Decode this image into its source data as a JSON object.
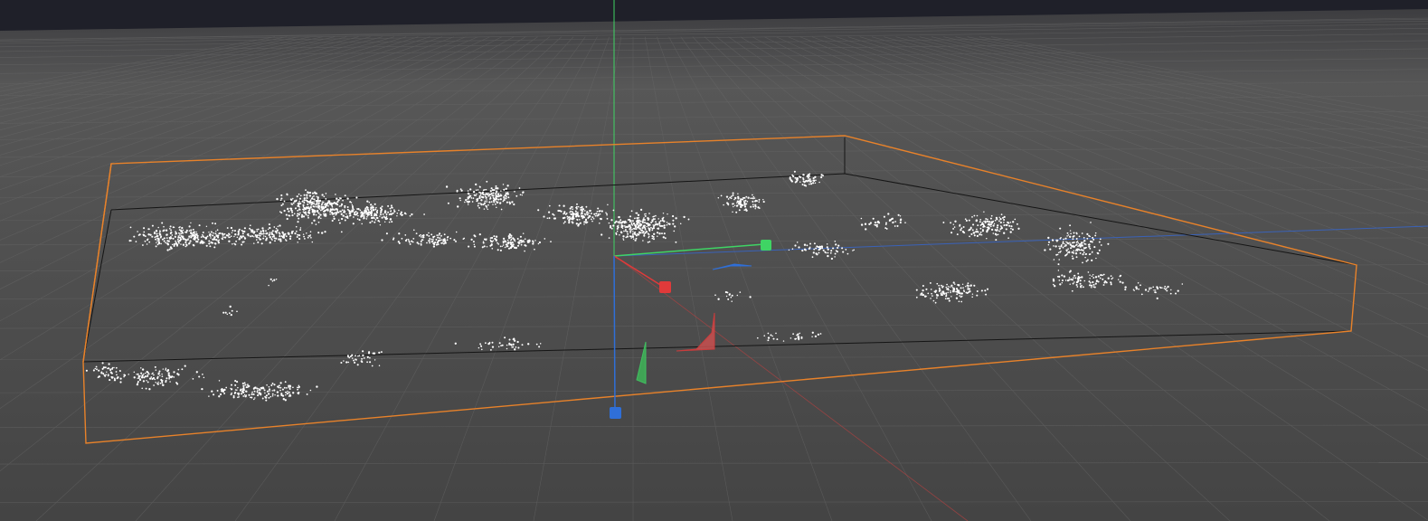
{
  "viewport": {
    "view": "perspective",
    "colors": {
      "sky": "#1e1f2a",
      "floor_far": "#565656",
      "floor_near": "#474747",
      "grid": "#626262",
      "selection": "#e8822a",
      "points": "#ffffff",
      "axis_x": "#e03a3a",
      "axis_y": "#3fd464",
      "axis_z": "#2f6fd8"
    }
  },
  "gizmo": {
    "handles": [
      {
        "axis": "x",
        "icon": "x-axis-handle-icon"
      },
      {
        "axis": "y",
        "icon": "y-axis-handle-icon"
      },
      {
        "axis": "z",
        "icon": "z-axis-handle-icon"
      }
    ]
  }
}
